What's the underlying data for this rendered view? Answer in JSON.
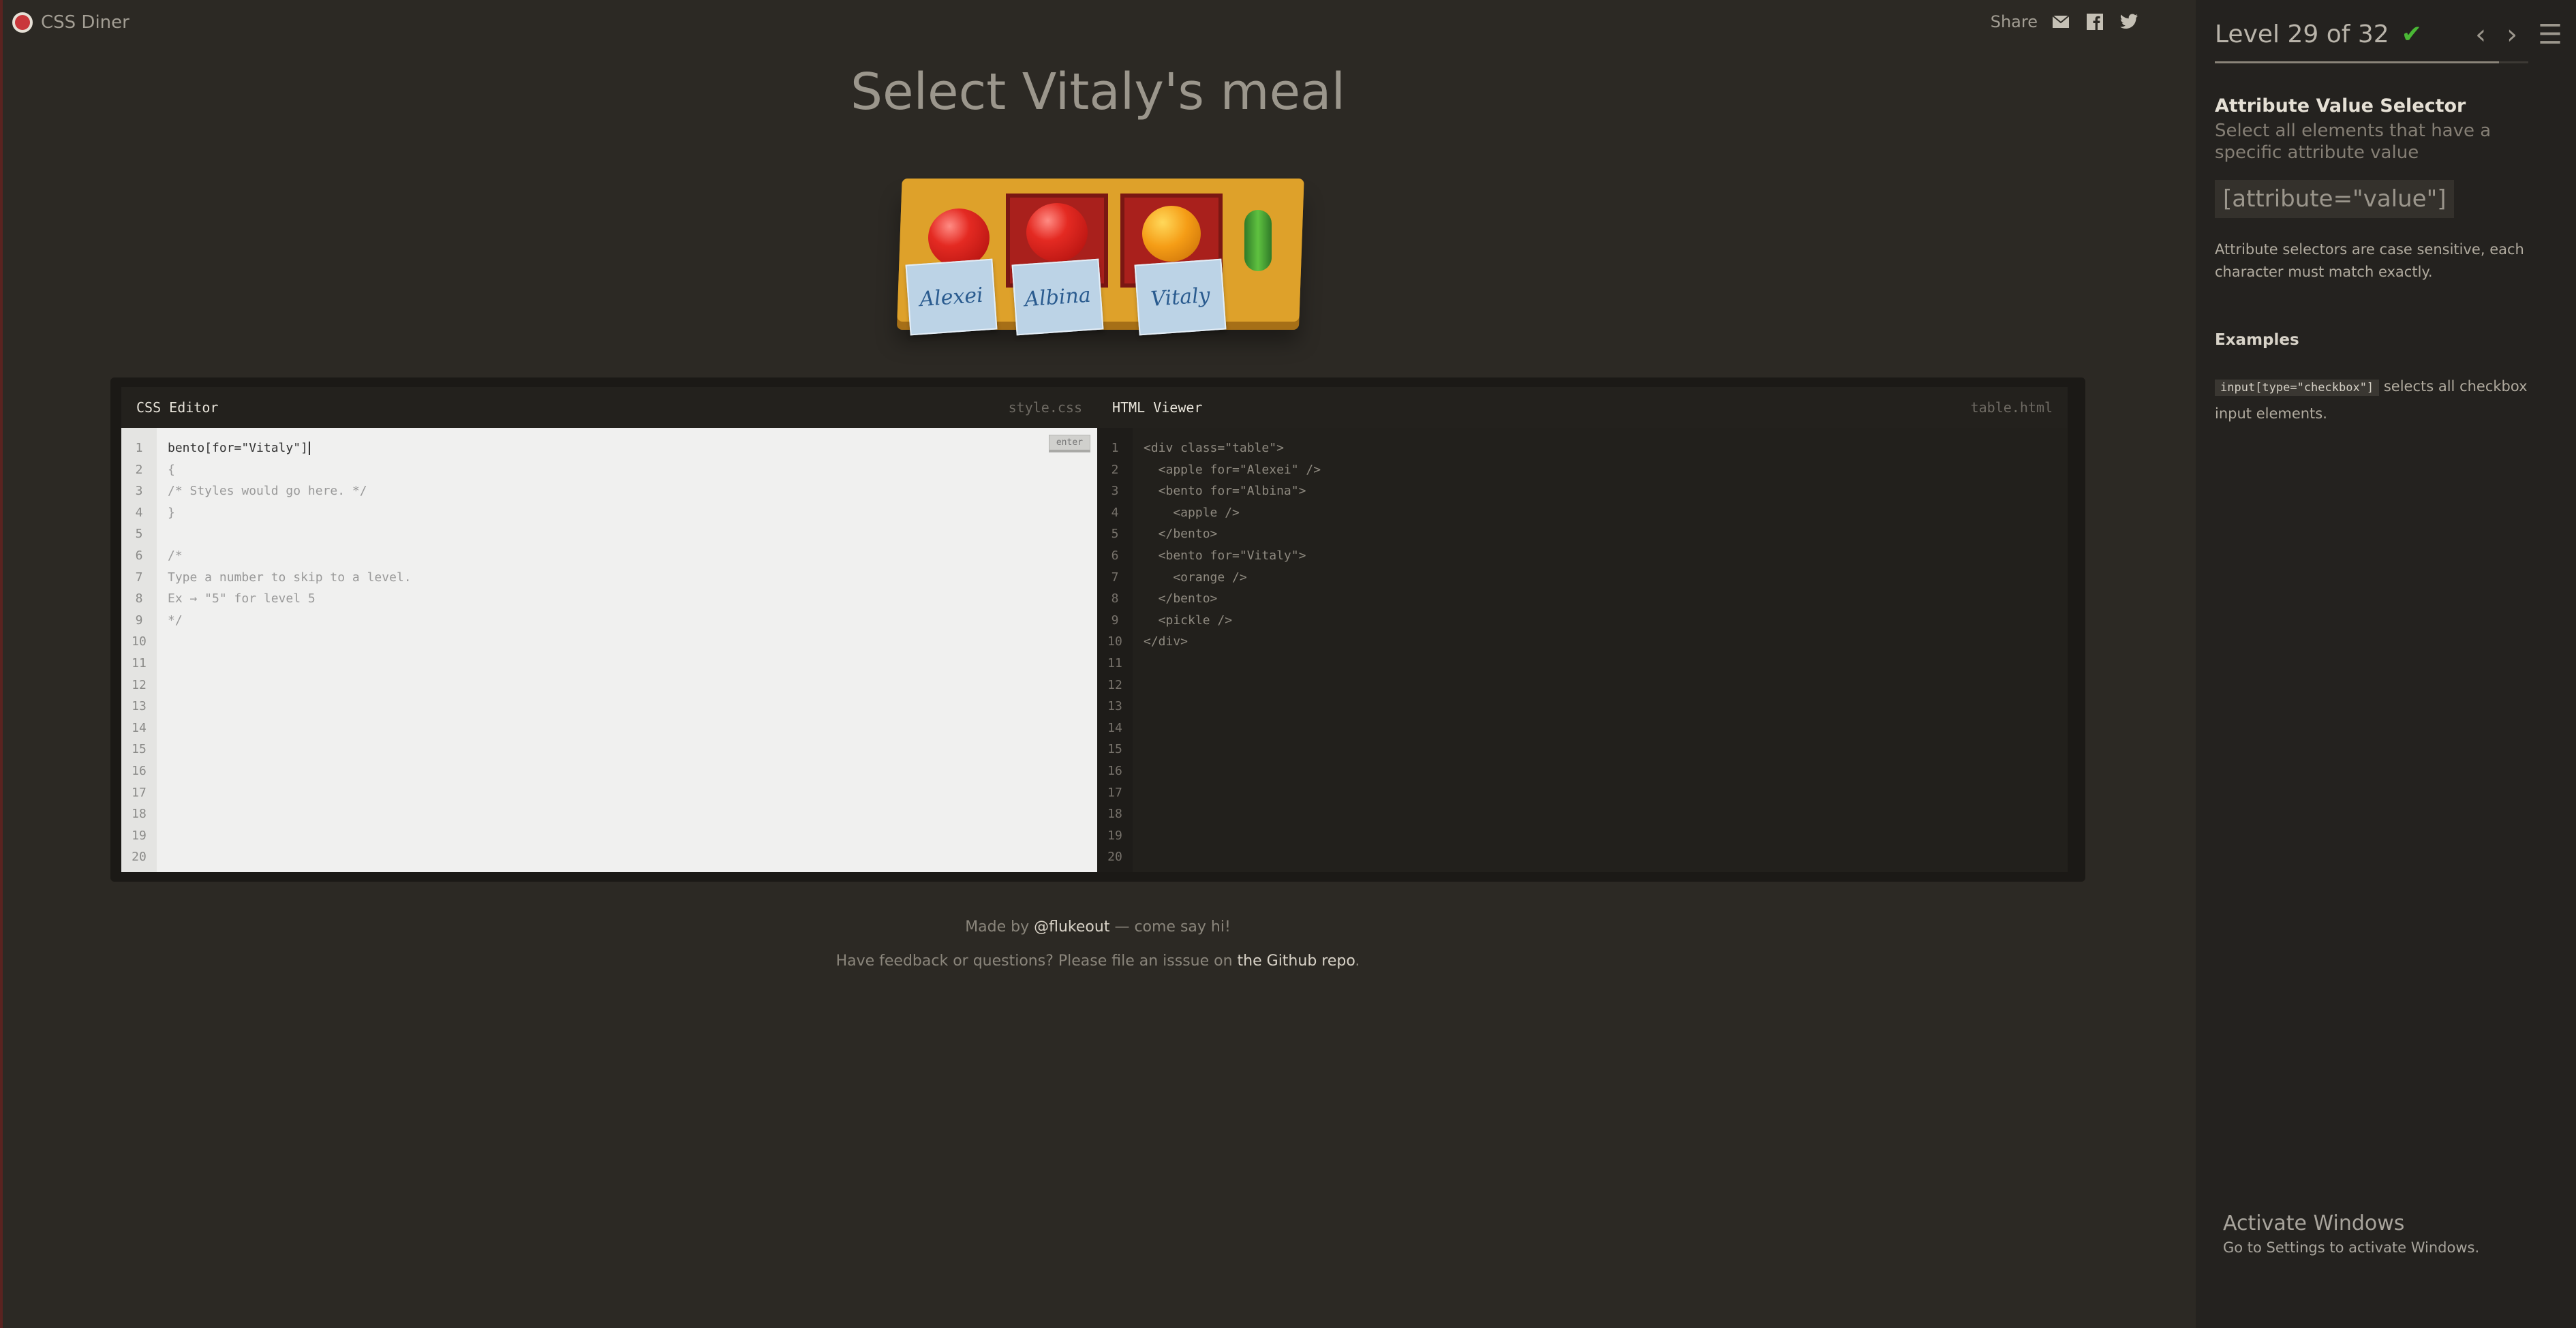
{
  "app": {
    "name": "CSS Diner"
  },
  "share": {
    "label": "Share",
    "icons": [
      "mail-icon",
      "facebook-icon",
      "twitter-icon"
    ]
  },
  "main": {
    "title": "Select Vitaly's meal"
  },
  "table": {
    "names": [
      "Alexei",
      "Albina",
      "Vitaly"
    ]
  },
  "css_editor": {
    "title": "CSS Editor",
    "file": "style.css",
    "enter_label": "enter",
    "input_value": "bento[for=\"Vitaly\"]",
    "lines": [
      "{",
      "/* Styles would go here. */",
      "}",
      "",
      "/*",
      "Type a number to skip to a level.",
      "Ex → \"5\" for level 5",
      "*/"
    ],
    "line_numbers": [
      "1",
      "2",
      "3",
      "4",
      "5",
      "6",
      "7",
      "8",
      "9",
      "10",
      "11",
      "12",
      "13",
      "14",
      "15",
      "16",
      "17",
      "18",
      "19",
      "20"
    ]
  },
  "html_viewer": {
    "title": "HTML Viewer",
    "file": "table.html",
    "lines": [
      "<div class=\"table\">",
      "  <apple for=\"Alexei\" />",
      "  <bento for=\"Albina\">",
      "    <apple />",
      "  </bento>",
      "  <bento for=\"Vitaly\">",
      "    <orange />",
      "  </bento>",
      "  <pickle />",
      "</div>"
    ],
    "line_numbers": [
      "1",
      "2",
      "3",
      "4",
      "5",
      "6",
      "7",
      "8",
      "9",
      "10",
      "11",
      "12",
      "13",
      "14",
      "15",
      "16",
      "17",
      "18",
      "19",
      "20"
    ]
  },
  "footer": {
    "made_by_prefix": "Made by ",
    "made_by_link": "@flukeout",
    "made_by_suffix": " — come say hi!",
    "feedback_prefix": "Have feedback or questions? Please file an isssue on ",
    "feedback_link": "the Github repo",
    "feedback_suffix": "."
  },
  "sidebar": {
    "level_text": "Level 29 of 32",
    "progress": 0.906,
    "selector_name": "Attribute Value Selector",
    "selector_desc": "Select all elements that have a specific attribute value",
    "syntax": "[attribute=\"value\"]",
    "hint": "Attribute selectors are case sensitive, each character must match exactly.",
    "examples_title": "Examples",
    "example_code": "input[type=\"checkbox\"]",
    "example_text": " selects all checkbox input elements."
  },
  "watermark": {
    "title": "Activate Windows",
    "subtitle": "Go to Settings to activate Windows."
  },
  "colors": {
    "accent_check": "#4ab835",
    "apple": "#e42a22",
    "orange": "#f59d16",
    "pickle": "#5fc240"
  }
}
